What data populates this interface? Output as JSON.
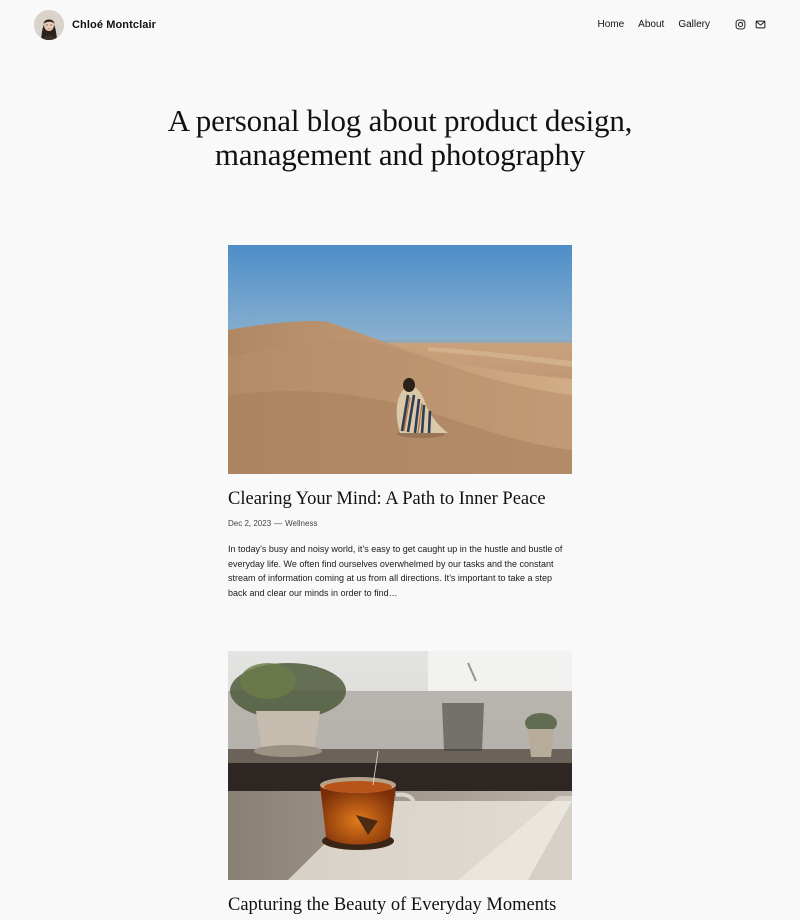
{
  "header": {
    "site_title": "Chloé Montclair",
    "nav": {
      "home": "Home",
      "about": "About",
      "gallery": "Gallery"
    },
    "social_icons": [
      "instagram-icon",
      "mail-icon"
    ]
  },
  "hero": {
    "line1": "A personal blog about product design,",
    "line2": "management and photography"
  },
  "posts": [
    {
      "title": "Clearing Your Mind: A Path to Inner Peace",
      "date": "Dec 2, 2023",
      "separator": "—",
      "category": "Wellness",
      "excerpt": "In today’s busy and noisy world, it’s easy to get caught up in the hustle and bustle of everyday life. We often find ourselves overwhelmed by our tasks and the constant stream of information coming at us from all directions. It’s important to take a step back and clear our minds in order to find…"
    },
    {
      "title": "Capturing the Beauty of Everyday Moments"
    }
  ],
  "colors": {
    "background": "#f9f9f9",
    "text": "#111111"
  }
}
